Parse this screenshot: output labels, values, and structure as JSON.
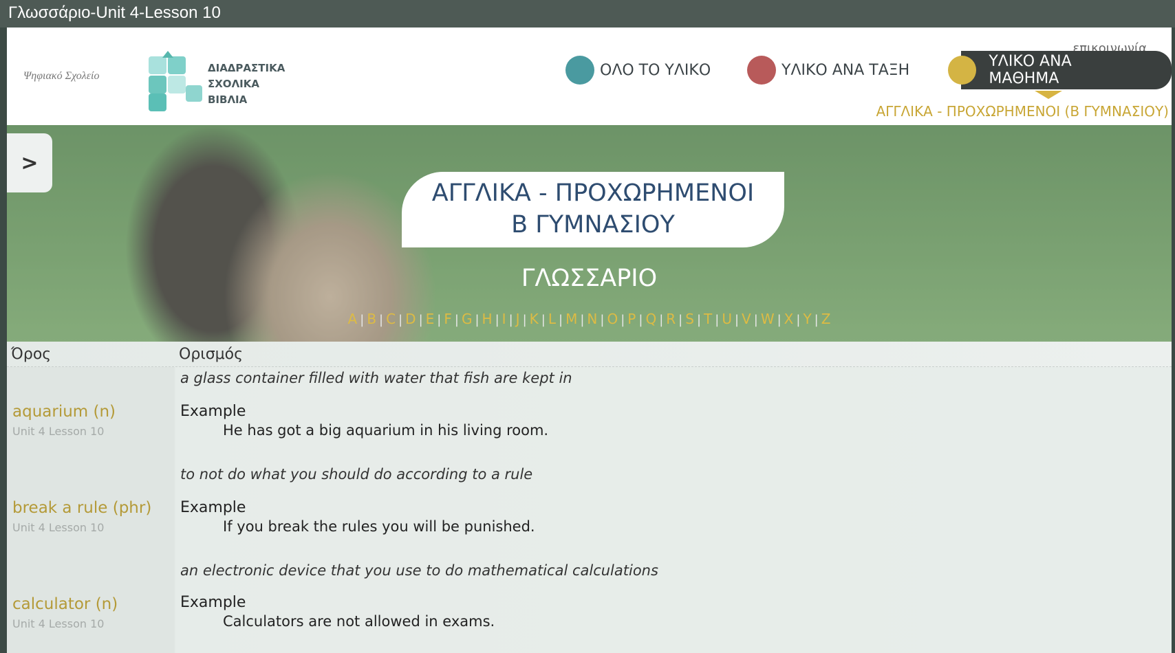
{
  "window": {
    "title": "Γλωσσάριο-Unit 4-Lesson 10"
  },
  "header": {
    "logo_left": "Ψηφιακό Σχολείο",
    "logo_text": [
      "ΔΙΑΔΡΑΣΤΙΚΑ",
      "ΣΧΟΛΙΚΑ",
      "ΒΙΒΛΙΑ"
    ],
    "contact": "επικοινωνία",
    "nav": [
      {
        "label": "ΟΛΟ ΤΟ ΥΛΙΚΟ",
        "color": "#4a9aa0"
      },
      {
        "label": "ΥΛΙΚΟ ΑΝΑ ΤΑΞΗ",
        "color": "#b85a5a"
      },
      {
        "label": "ΥΛΙΚΟ ΑΝΑ ΜΑΘΗΜΑ",
        "color": "#d4b444"
      }
    ],
    "breadcrumb": "ΑΓΓΛΙΚΑ - ΠΡΟΧΩΡΗΜΕΝΟΙ (Β ΓΥΜΝΑΣΙΟΥ)"
  },
  "sidebar_toggle": ">",
  "hero": {
    "title_line1": "ΑΓΓΛΙΚΑ - ΠΡΟΧΩΡΗΜΕΝΟΙ",
    "title_line2": "Β ΓΥΜΝΑΣΙΟΥ",
    "subtitle": "ΓΛΩΣΣΑΡΙΟ",
    "letters": [
      "A",
      "B",
      "C",
      "D",
      "E",
      "F",
      "G",
      "H",
      "I",
      "J",
      "K",
      "L",
      "M",
      "N",
      "O",
      "P",
      "Q",
      "R",
      "S",
      "T",
      "U",
      "V",
      "W",
      "X",
      "Y",
      "Z"
    ]
  },
  "table": {
    "col_term": "Όρος",
    "col_definition": "Ορισμός",
    "rows": [
      {
        "term": "aquarium (n)",
        "unit": "Unit 4 Lesson 10",
        "definition": "a glass container filled with water that fish are kept in",
        "example_label": "Example",
        "example": "He has got a big aquarium in his living room."
      },
      {
        "term": "break a rule (phr)",
        "unit": "Unit 4 Lesson 10",
        "definition": "to not do what you should do according to a rule",
        "example_label": "Example",
        "example": "If you break the rules you will be punished."
      },
      {
        "term": "calculator (n)",
        "unit": "Unit 4 Lesson 10",
        "definition": "an electronic device that you use to do mathematical calculations",
        "example_label": "Example",
        "example": "Calculators are not allowed in exams."
      }
    ]
  }
}
